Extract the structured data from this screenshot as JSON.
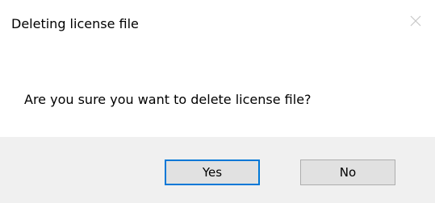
{
  "window": {
    "title": "Deleting license file",
    "close_icon": "close-icon"
  },
  "message": {
    "text": "Are you sure you want to delete license file?"
  },
  "buttons": {
    "yes_label": "Yes",
    "no_label": "No"
  },
  "colors": {
    "footer_background": "#f0f0f0",
    "default_button_border": "#0078d7",
    "button_background": "#e1e1e1"
  }
}
